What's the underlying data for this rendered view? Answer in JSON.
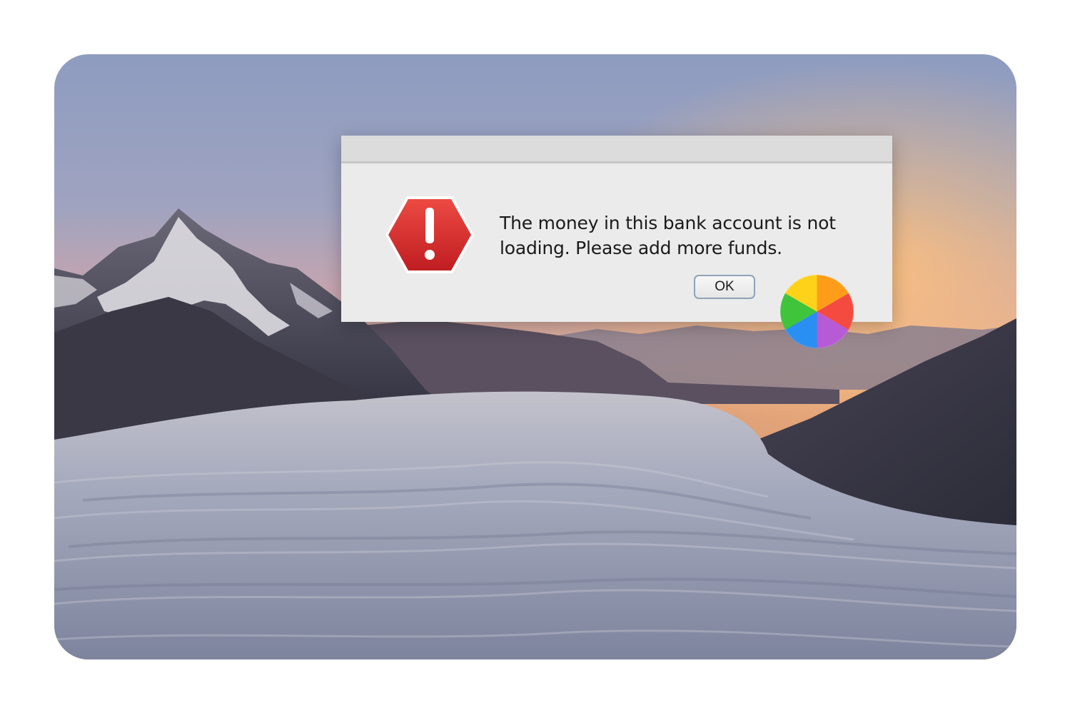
{
  "alert": {
    "message": "The money in this bank account is not loading. Please add more funds.",
    "ok_label": "OK",
    "icon": "stop-warning-icon",
    "icon_color": "#d42a2a"
  },
  "cursor": {
    "icon": "spinning-wait-cursor-icon",
    "colors": [
      "#ff9d1a",
      "#f54a3f",
      "#b75ad6",
      "#2a8ff2",
      "#3fc43b",
      "#ffd21a"
    ]
  },
  "wallpaper": {
    "icon": "mountain-sea-of-clouds-wallpaper",
    "sky_top": "#8c9bbd",
    "sunset": "#f3a66a",
    "clouds": "#a5abbd"
  }
}
